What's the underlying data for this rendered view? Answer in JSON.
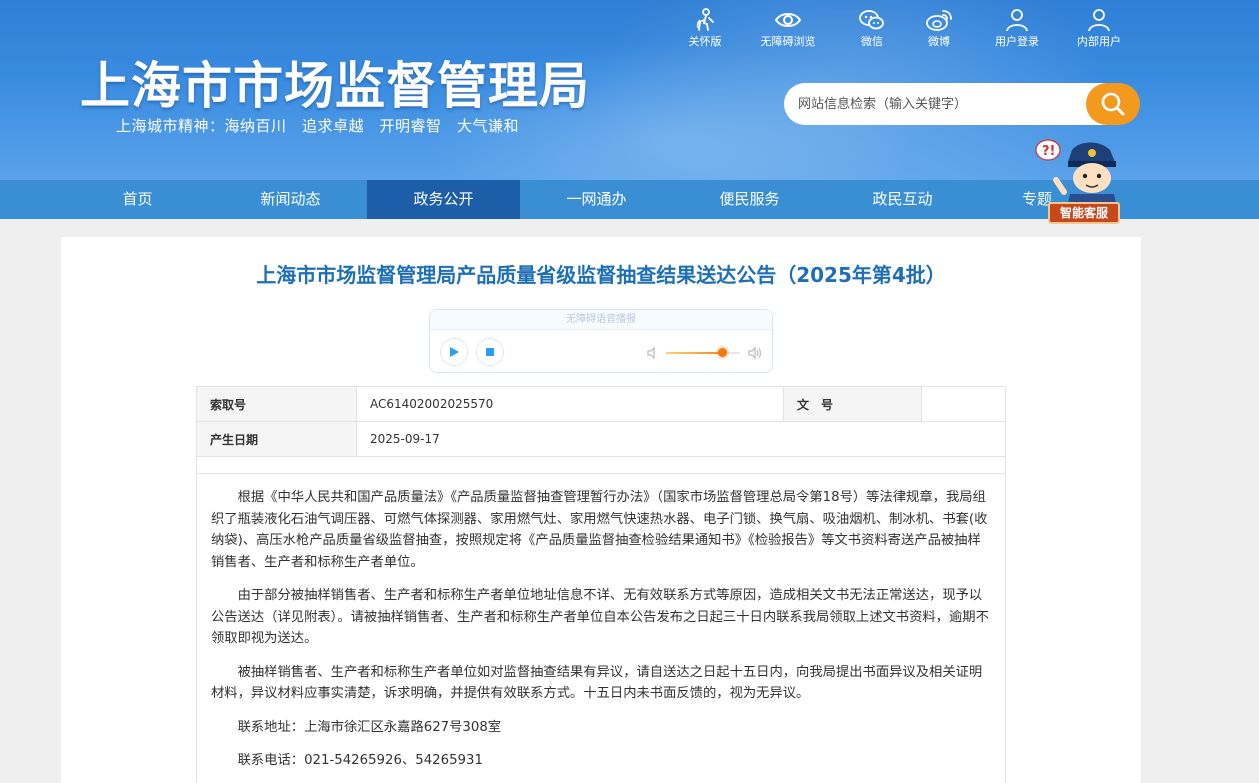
{
  "header": {
    "site_title": "上海市市场监督管理局",
    "slogan": "上海城市精神：海纳百川　追求卓越　开明睿智　大气谦和",
    "toplinks": [
      {
        "label": "关怀版",
        "icon": "elder-care-icon"
      },
      {
        "label": "无障碍浏览",
        "icon": "eye-icon"
      },
      {
        "label": "微信",
        "icon": "wechat-icon"
      },
      {
        "label": "微博",
        "icon": "weibo-icon"
      },
      {
        "label": "用户登录",
        "icon": "user-icon"
      },
      {
        "label": "内部用户",
        "icon": "user-icon"
      }
    ],
    "search_placeholder": "网站信息检索（输入关键字）"
  },
  "nav": {
    "items": [
      "首页",
      "新闻动态",
      "政务公开",
      "一网通办",
      "便民服务",
      "政民互动",
      "专题"
    ],
    "active_index": 2
  },
  "robot": {
    "label": "智能客服"
  },
  "article": {
    "title": "上海市市场监督管理局产品质量省级监督抽查结果送达公告（2025年第4批）",
    "player": {
      "header": "无障碍语音播报",
      "volume": 0.75
    },
    "meta": {
      "index_label": "索取号",
      "index_value": "AC61402002025570",
      "doc_label": "文　号",
      "doc_value": "",
      "date_label": "产生日期",
      "date_value": "2025-09-17"
    },
    "paragraphs": [
      "根据《中华人民共和国产品质量法》《产品质量监督抽查管理暂行办法》（国家市场监督管理总局令第18号）等法律规章，我局组织了瓶装液化石油气调压器、可燃气体探测器、家用燃气灶、家用燃气快速热水器、电子门锁、换气扇、吸油烟机、制冰机、书套(收纳袋)、高压水枪产品质量省级监督抽查，按照规定将《产品质量监督抽查检验结果通知书》《检验报告》等文书资料寄送产品被抽样销售者、生产者和标称生产者单位。",
      "由于部分被抽样销售者、生产者和标称生产者单位地址信息不详、无有效联系方式等原因，造成相关文书无法正常送达，现予以公告送达（详见附表）。请被抽样销售者、生产者和标称生产者单位自本公告发布之日起三十日内联系我局领取上述文书资料，逾期不领取即视为送达。",
      "被抽样销售者、生产者和标称生产者单位如对监督抽查结果有异议，请自送达之日起十五日内，向我局提出书面异议及相关证明材料，异议材料应事实清楚，诉求明确，并提供有效联系方式。十五日内未书面反馈的，视为无异议。",
      "联系地址：上海市徐汇区永嘉路627号308室",
      "联系电话：021-54265926、54265931"
    ]
  }
}
